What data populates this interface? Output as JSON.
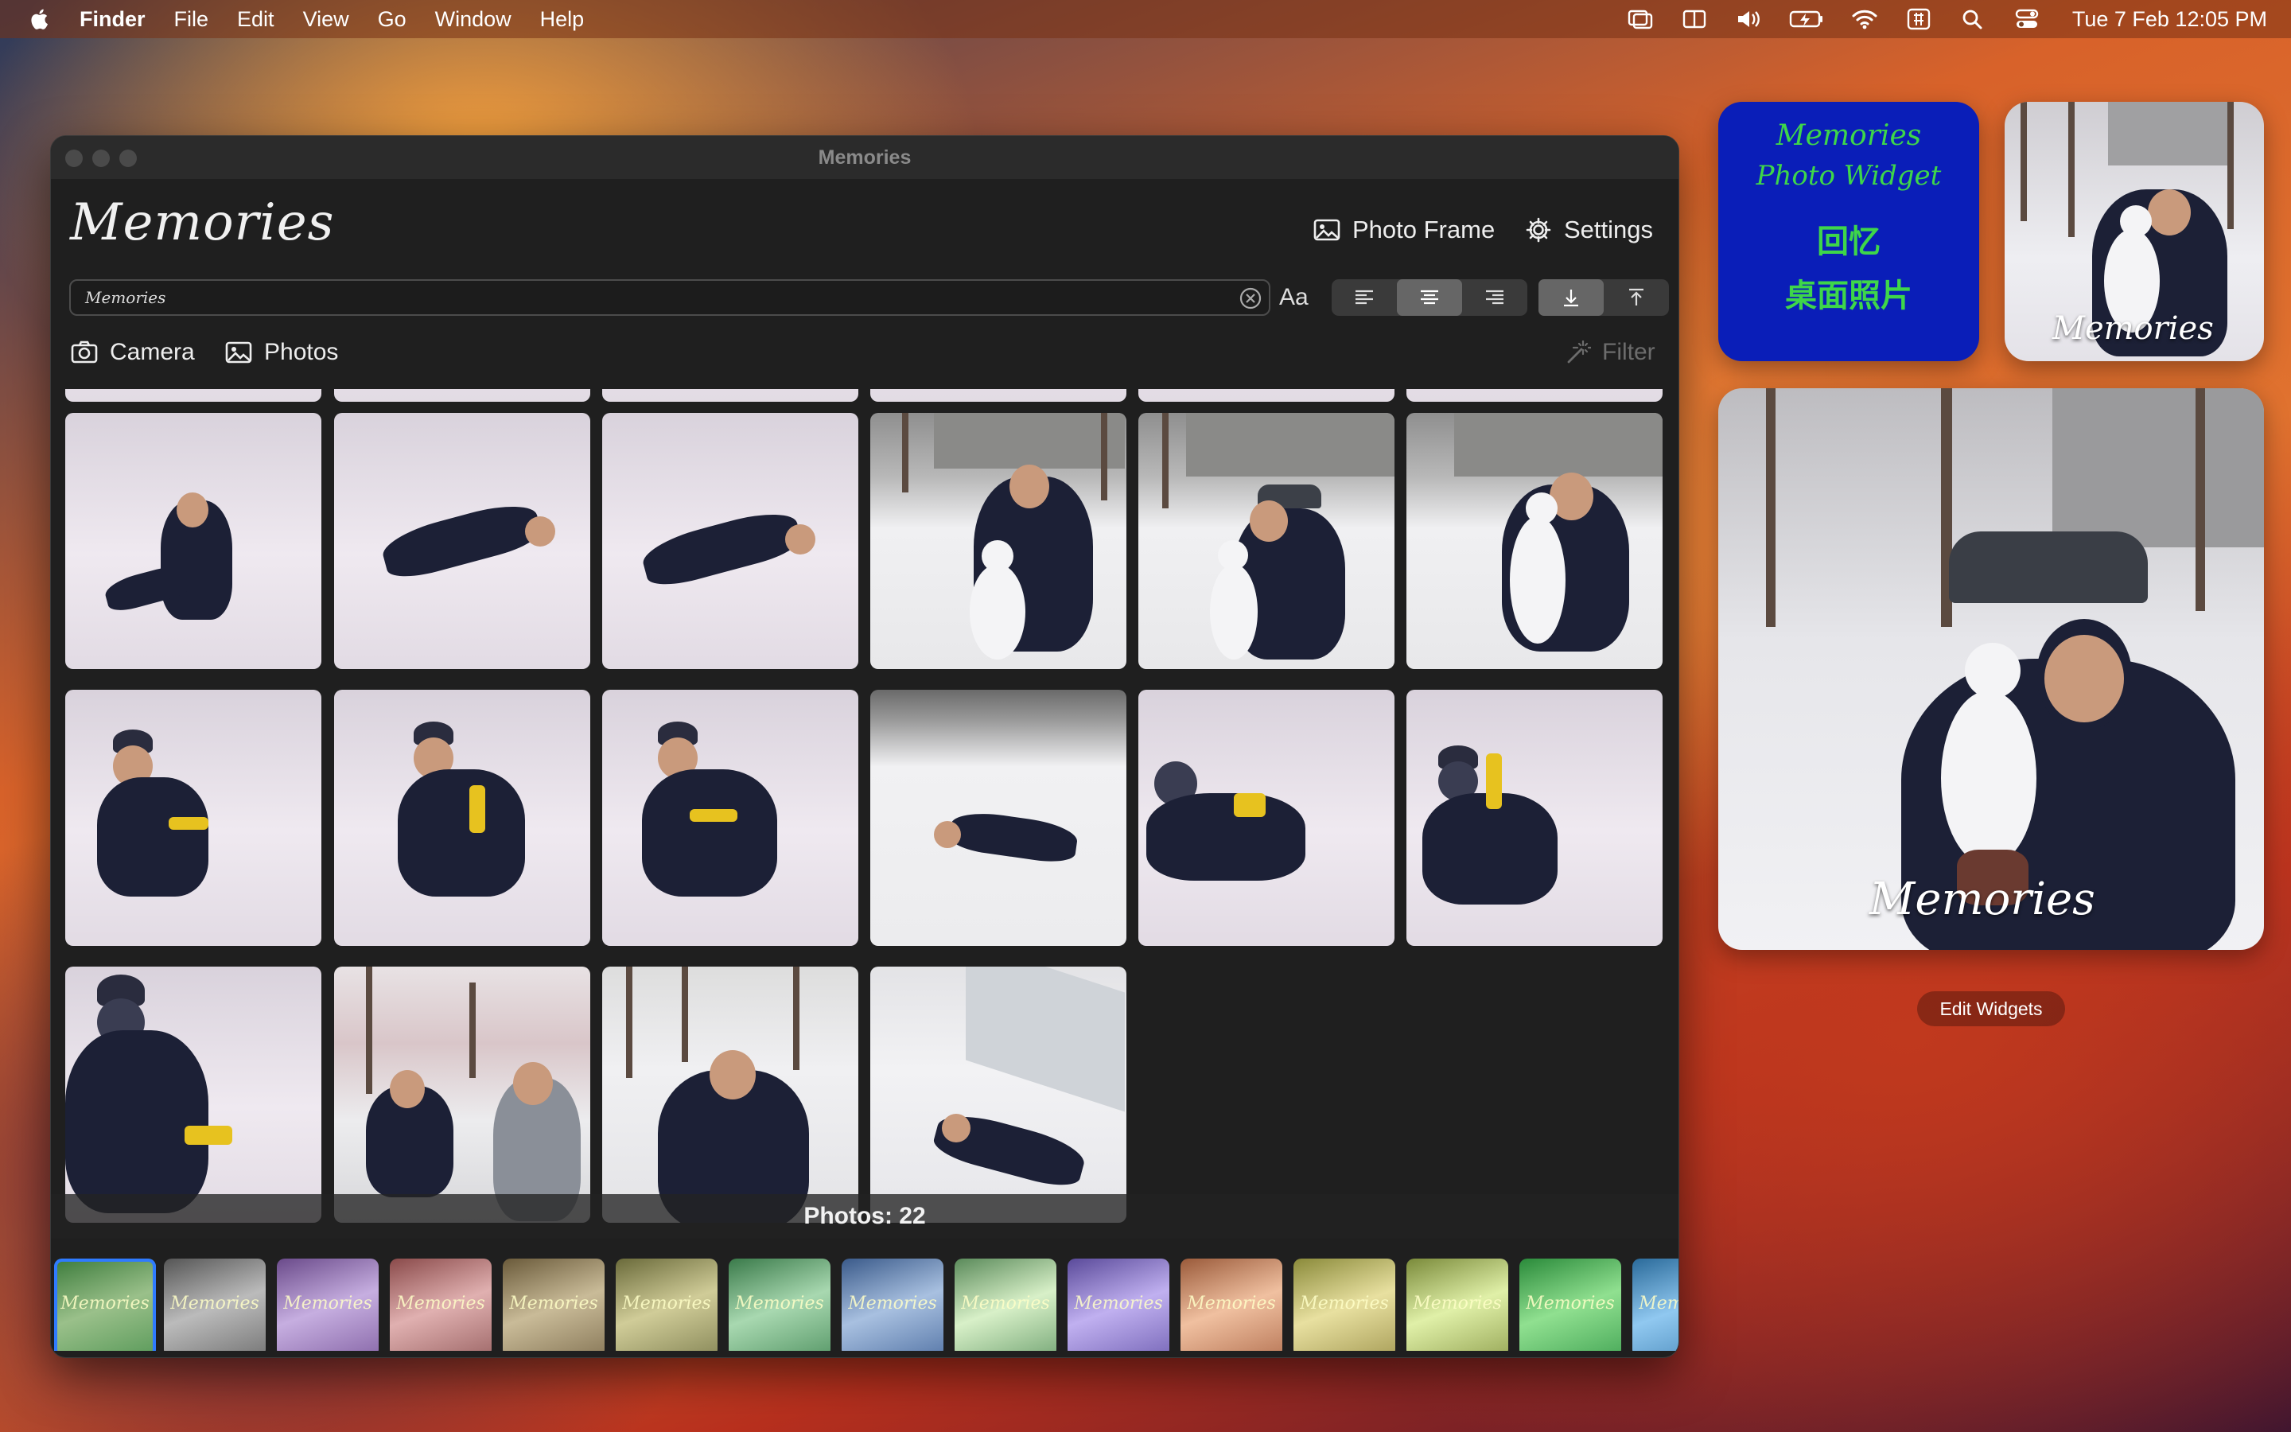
{
  "menubar": {
    "app": "Finder",
    "items": [
      "File",
      "Edit",
      "View",
      "Go",
      "Window",
      "Help"
    ],
    "clock": "Tue 7 Feb  12:05 PM",
    "status_icons": [
      "display-icon",
      "split-view-icon",
      "volume-icon",
      "battery-charging-icon",
      "wifi-icon",
      "input-method-icon",
      "spotlight-icon",
      "control-center-icon"
    ]
  },
  "window": {
    "title": "Memories",
    "app_title": "Memories",
    "photo_frame_label": "Photo Frame",
    "settings_label": "Settings",
    "search_value": "Memories",
    "font_button": "Aa",
    "camera_label": "Camera",
    "photos_label": "Photos",
    "filter_label": "Filter",
    "photo_count": "Photos: 22",
    "filter_thumb_label": "Memories",
    "colors": {
      "accent": "#2f7bff",
      "window_bg": "#1f1f1f"
    }
  },
  "widgets": {
    "blue": {
      "line1": "Memories",
      "line2": "Photo Widget",
      "line3": "回忆",
      "line4": "桌面照片",
      "bg": "#0a1eb8",
      "fg": "#3ed64a"
    },
    "small_caption": "Memories",
    "large_caption": "Memories",
    "edit_label": "Edit Widgets"
  }
}
